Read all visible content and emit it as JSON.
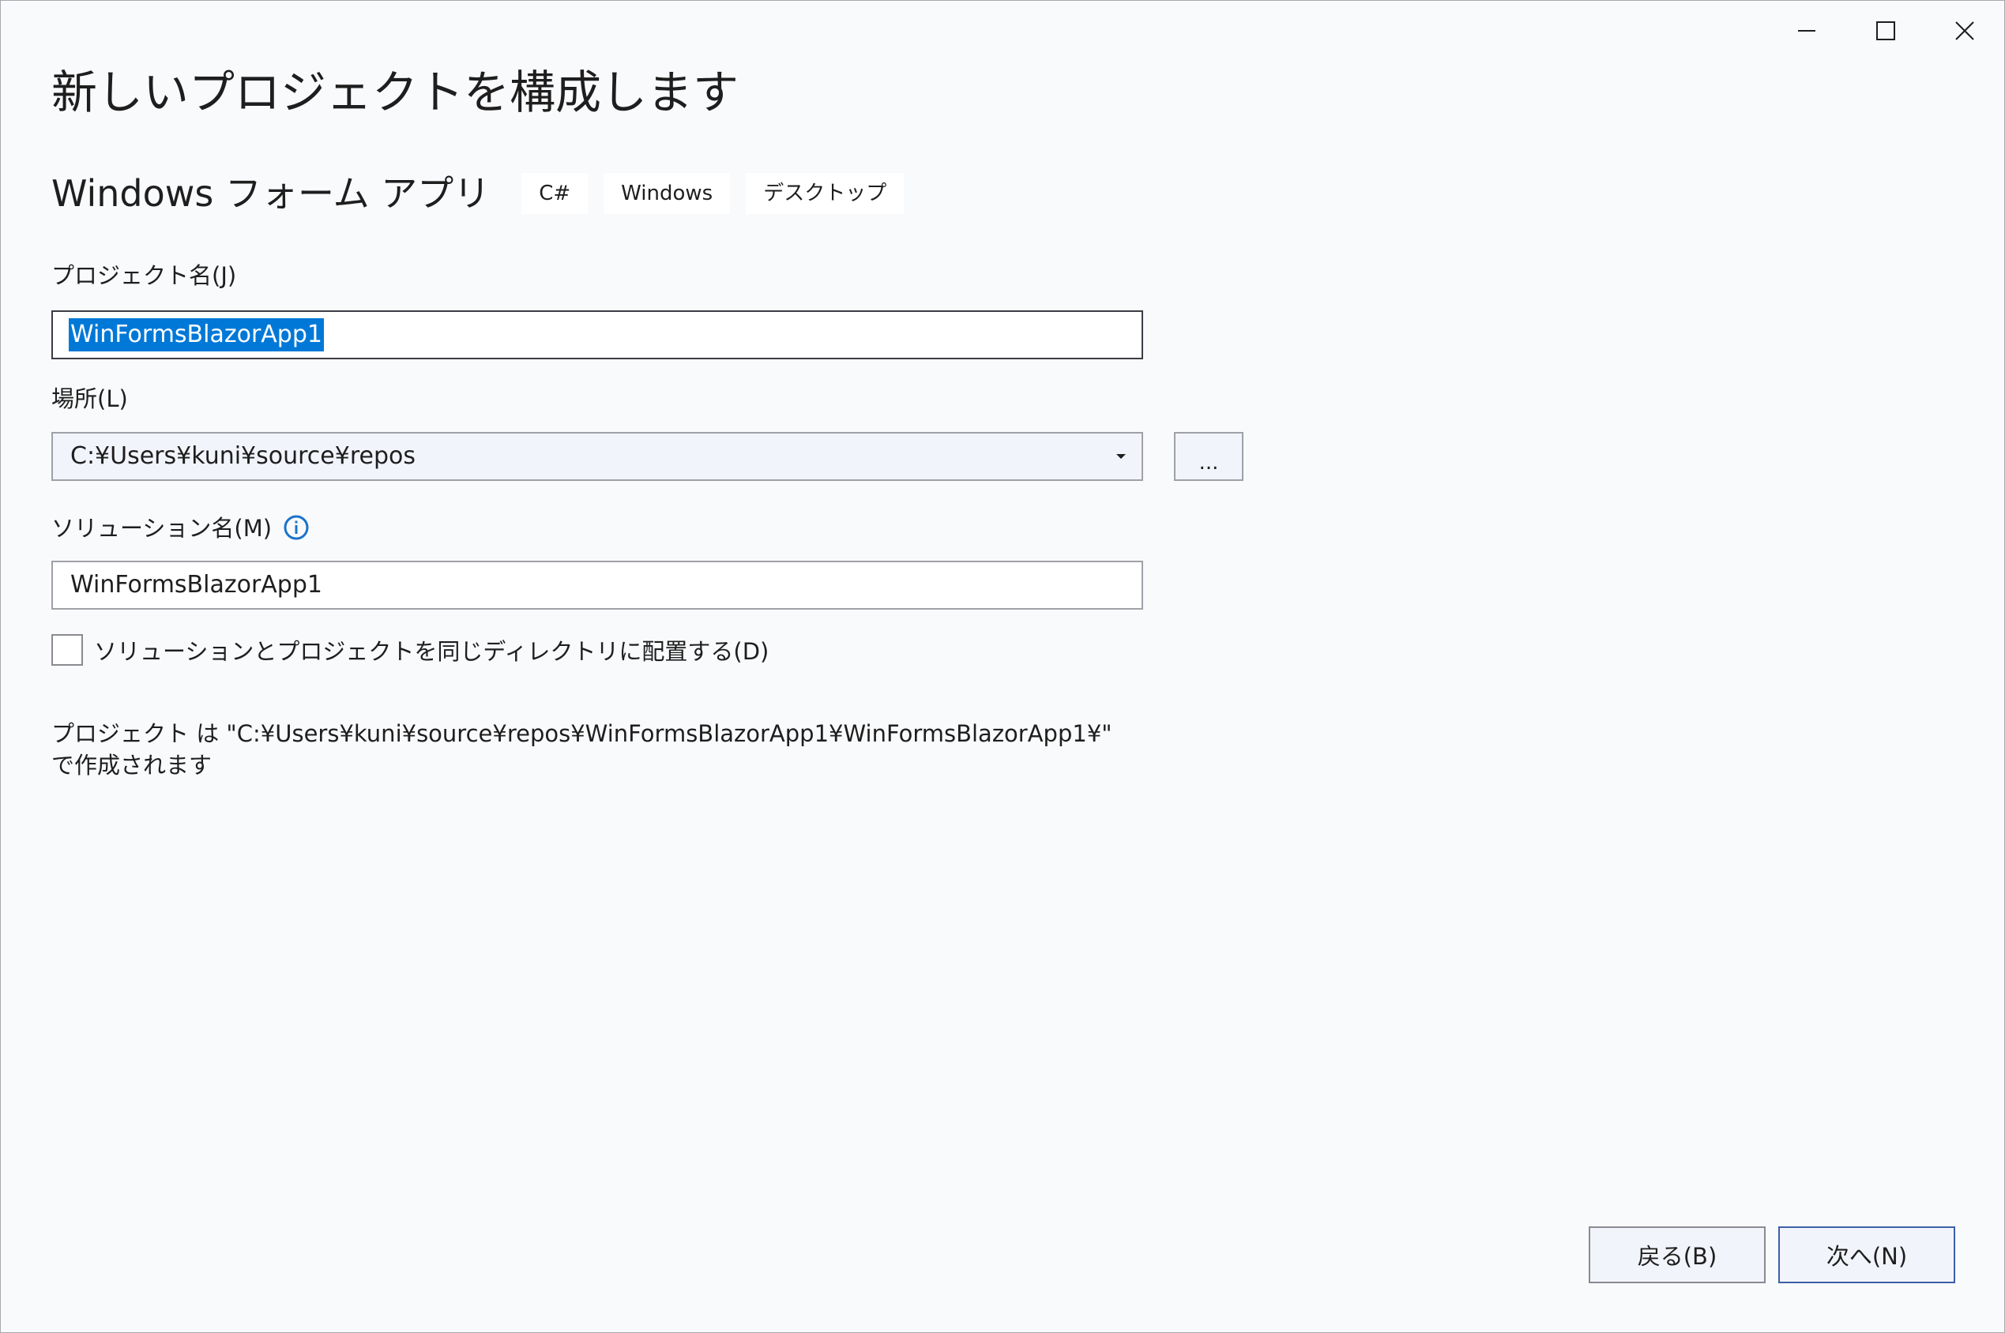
{
  "window": {
    "controls": [
      "minimize-icon",
      "maximize-icon",
      "close-icon"
    ]
  },
  "header": {
    "title": "新しいプロジェクトを構成します"
  },
  "template": {
    "name": "Windows フォーム アプリ",
    "tags": [
      "C#",
      "Windows",
      "デスクトップ"
    ]
  },
  "form": {
    "project_name_label": "プロジェクト名(J)",
    "project_name_value": "WinFormsBlazorApp1",
    "location_label": "場所(L)",
    "location_value": "C:¥Users¥kuni¥source¥repos",
    "browse_label": "...",
    "solution_name_label": "ソリューション名(M)",
    "solution_name_value": "WinFormsBlazorApp1",
    "same_dir_label": "ソリューションとプロジェクトを同じディレクトリに配置する(D)",
    "same_dir_checked": false,
    "path_info": "プロジェクト は \"C:¥Users¥kuni¥source¥repos¥WinFormsBlazorApp1¥WinFormsBlazorApp1¥\" で作成されます"
  },
  "footer": {
    "back_label": "戻る(B)",
    "next_label": "次へ(N)"
  },
  "colors": {
    "background": "#f9fafc",
    "selection": "#0078d7",
    "info_icon": "#1a73c8",
    "primary_border": "#3c5fa8"
  }
}
